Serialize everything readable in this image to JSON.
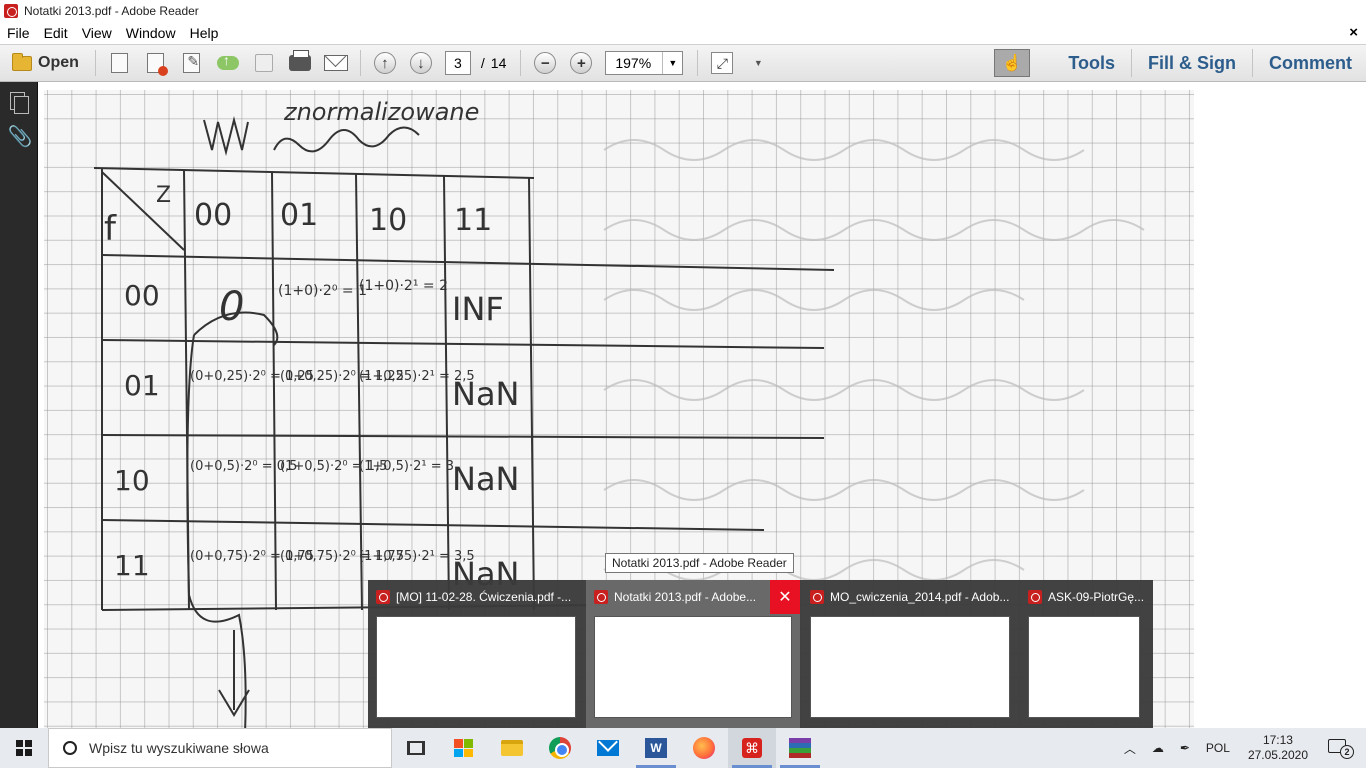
{
  "window": {
    "title": "Notatki 2013.pdf - Adobe Reader"
  },
  "menu": {
    "items": [
      "File",
      "Edit",
      "View",
      "Window",
      "Help"
    ],
    "close": "×"
  },
  "toolbar": {
    "open_label": "Open",
    "page_current": "3",
    "page_separator": "/",
    "page_total": "14",
    "zoom_minus": "−",
    "zoom_plus": "+",
    "zoom_value": "197%",
    "tools_label": "Tools",
    "fill_sign_label": "Fill & Sign",
    "comment_label": "Comment"
  },
  "document": {
    "heading": "znormalizowane",
    "col_headers": [
      "00",
      "01",
      "10",
      "11"
    ],
    "corner_labels": [
      "Z",
      "f"
    ],
    "rows": [
      {
        "label": "00",
        "cells": [
          "0",
          "(1+0)·2⁰ = 1",
          "(1+0)·2¹ = 2",
          "INF"
        ]
      },
      {
        "label": "01",
        "cells": [
          "(0+0,25)·2⁰ = 0,25",
          "(1+0,25)·2⁰ = 1,25",
          "(1+0,25)·2¹ = 2,5",
          "NaN"
        ]
      },
      {
        "label": "10",
        "cells": [
          "(0+0,5)·2⁰ = 0,5",
          "(1+0,5)·2⁰ = 1,5",
          "(1+0,5)·2¹ = 3",
          "NaN"
        ]
      },
      {
        "label": "11",
        "cells": [
          "(0+0,75)·2⁰ = 0,75",
          "(1+0,75)·2⁰ = 1,75",
          "(1+0,75)·2¹ = 3,5",
          "NaN"
        ]
      }
    ]
  },
  "taskbar_previews": {
    "tooltip": "Notatki 2013.pdf - Adobe Reader",
    "items": [
      {
        "title": "[MO] 11-02-28. Ćwiczenia.pdf -..."
      },
      {
        "title": "Notatki 2013.pdf - Adobe..."
      },
      {
        "title": "MO_cwiczenia_2014.pdf - Adob..."
      },
      {
        "title": "ASK-09-PiotrGę..."
      }
    ],
    "close": "✕"
  },
  "taskbar": {
    "search_placeholder": "Wpisz tu wyszukiwane słowa",
    "language": "POL",
    "time": "17:13",
    "date": "27.05.2020",
    "notification_count": "2"
  },
  "colors": {
    "accent": "#2c5d8c",
    "close_red": "#e81123",
    "taskbar_bg": "#e7eaee"
  }
}
